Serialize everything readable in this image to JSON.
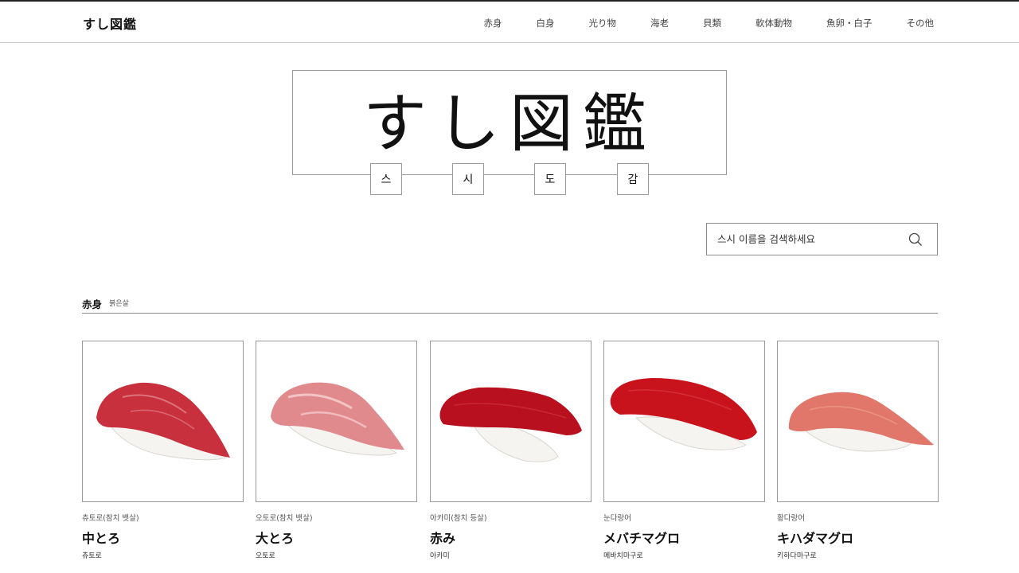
{
  "header": {
    "logo": "すし図鑑",
    "nav": [
      "赤身",
      "白身",
      "光り物",
      "海老",
      "貝類",
      "軟体動物",
      "魚卵・白子",
      "その他"
    ]
  },
  "hero": {
    "title": "すし図鑑",
    "sub": [
      "스",
      "시",
      "도",
      "감"
    ]
  },
  "search": {
    "placeholder": "스시 이름을 검색하세요"
  },
  "section": {
    "title": "赤身",
    "subtitle": "붉은살"
  },
  "cards": [
    {
      "ko": "츄토로(참치 뱃살)",
      "jp": "中とろ",
      "kr": "츄토로",
      "fish_color": "#c9303d",
      "image": "chutoro-sushi"
    },
    {
      "ko": "오토로(참치 뱃살)",
      "jp": "大とろ",
      "kr": "오토로",
      "fish_color": "#e08a8e",
      "image": "otoro-sushi"
    },
    {
      "ko": "아카미(참치 등살)",
      "jp": "赤み",
      "kr": "아카미",
      "fish_color": "#b8101e",
      "image": "akami-sushi"
    },
    {
      "ko": "눈다랑어",
      "jp": "メバチマグロ",
      "kr": "메바치마구로",
      "fish_color": "#c8131c",
      "image": "mebachi-sushi"
    },
    {
      "ko": "황다랑어",
      "jp": "キハダマグロ",
      "kr": "키하다마구로",
      "fish_color": "#e0776a",
      "image": "kihada-sushi"
    }
  ]
}
